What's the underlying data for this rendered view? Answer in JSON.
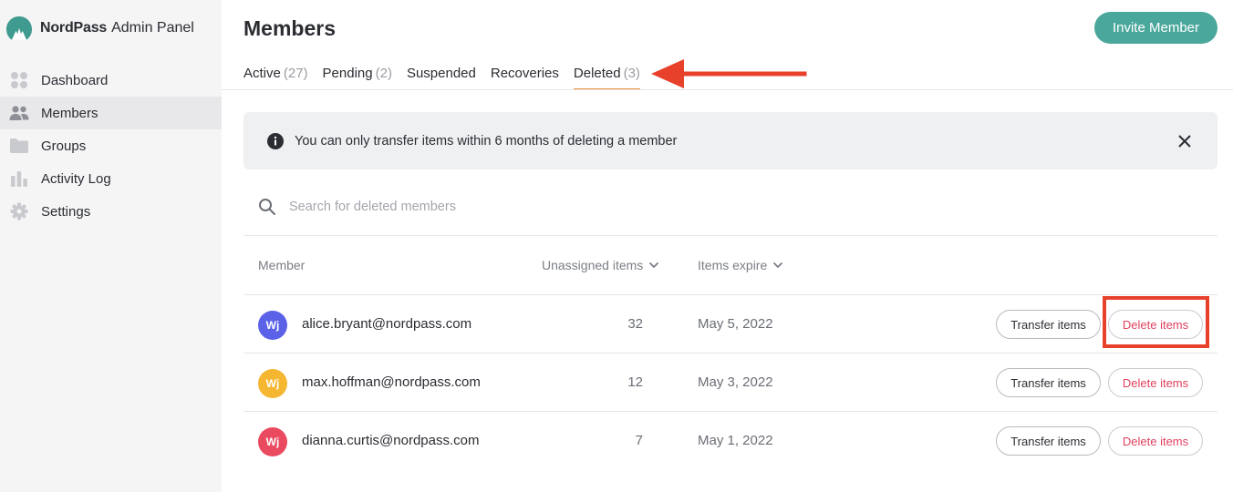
{
  "brand": {
    "name": "NordPass",
    "subtitle": "Admin Panel"
  },
  "sidebar": {
    "items": [
      {
        "label": "Dashboard",
        "icon": "dashboard-icon",
        "active": false
      },
      {
        "label": "Members",
        "icon": "members-icon",
        "active": true
      },
      {
        "label": "Groups",
        "icon": "folder-icon",
        "active": false
      },
      {
        "label": "Activity Log",
        "icon": "bar-chart-icon",
        "active": false
      },
      {
        "label": "Settings",
        "icon": "gear-icon",
        "active": false
      }
    ]
  },
  "header": {
    "title": "Members",
    "invite_label": "Invite Member"
  },
  "tabs": [
    {
      "label": "Active",
      "count": "(27)"
    },
    {
      "label": "Pending",
      "count": "(2)"
    },
    {
      "label": "Suspended",
      "count": ""
    },
    {
      "label": "Recoveries",
      "count": ""
    },
    {
      "label": "Deleted",
      "count": "(3)"
    }
  ],
  "banner": {
    "text": "You can only transfer items within 6 months of deleting a member"
  },
  "search": {
    "placeholder": "Search for deleted members"
  },
  "table": {
    "headers": {
      "member": "Member",
      "unassigned": "Unassigned items",
      "expire": "Items expire"
    },
    "rows": [
      {
        "initials": "Wj",
        "email": "alice.bryant@nordpass.com",
        "count": "32",
        "expire": "May 5, 2022",
        "transfer": "Transfer items",
        "delete": "Delete items",
        "color": "#5b62e8"
      },
      {
        "initials": "Wj",
        "email": "max.hoffman@nordpass.com",
        "count": "12",
        "expire": "May 3, 2022",
        "transfer": "Transfer items",
        "delete": "Delete items",
        "color": "#f5b731"
      },
      {
        "initials": "Wj",
        "email": "dianna.curtis@nordpass.com",
        "count": "7",
        "expire": "May 1, 2022",
        "transfer": "Transfer items",
        "delete": "Delete items",
        "color": "#ea4a5f"
      }
    ]
  },
  "colors": {
    "accent": "#4aa79b",
    "tab_underline": "#e8923b",
    "annotation": "#e8412b",
    "danger": "#e0415e"
  }
}
